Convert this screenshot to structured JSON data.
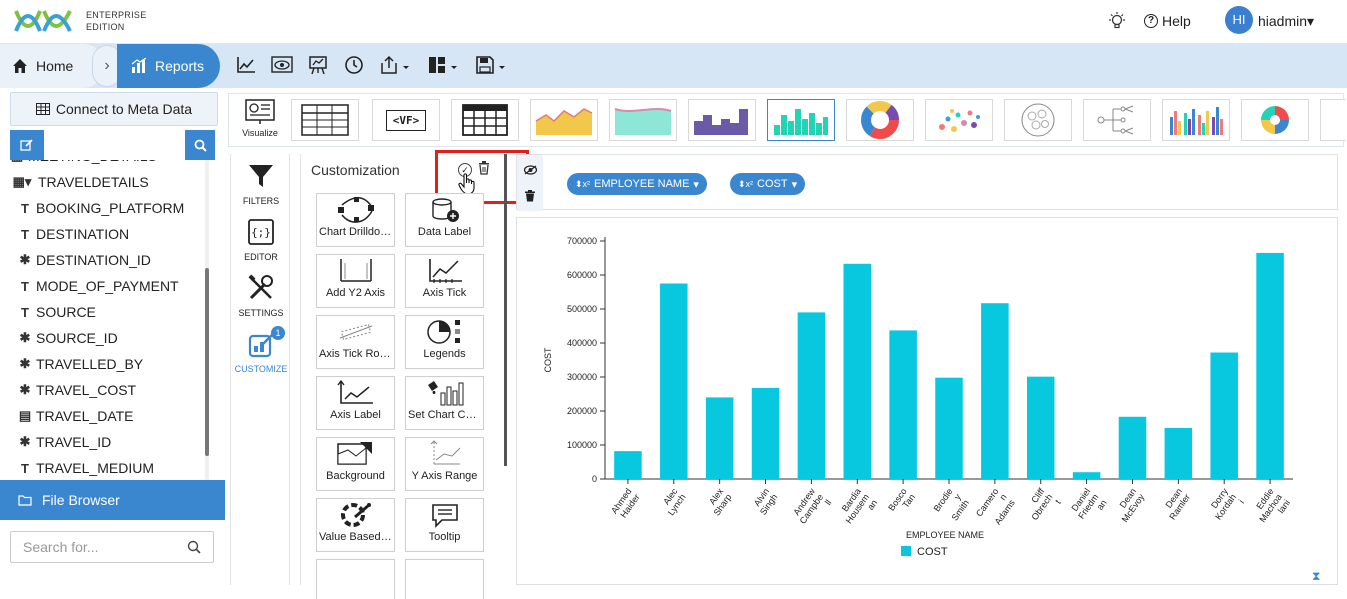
{
  "app": {
    "edition_line1": "ENTERPRISE",
    "edition_line2": "EDITION",
    "help_label": "Help",
    "avatar_initials": "HI",
    "username": "hiadmin",
    "accent_color": "#3a87d0"
  },
  "nav": {
    "home_label": "Home",
    "reports_label": "Reports"
  },
  "left_panel": {
    "connect_label": "Connect to Meta Data",
    "tree": [
      {
        "icon": "table-icon",
        "label": "MEETING_DETAILS"
      },
      {
        "icon": "table-expand-icon",
        "label": "TRAVELDETAILS"
      },
      {
        "icon": "text-type-icon",
        "label": "BOOKING_PLATFORM"
      },
      {
        "icon": "text-type-icon",
        "label": "DESTINATION"
      },
      {
        "icon": "numeric-type-icon",
        "label": "DESTINATION_ID"
      },
      {
        "icon": "text-type-icon",
        "label": "MODE_OF_PAYMENT"
      },
      {
        "icon": "text-type-icon",
        "label": "SOURCE"
      },
      {
        "icon": "numeric-type-icon",
        "label": "SOURCE_ID"
      },
      {
        "icon": "numeric-type-icon",
        "label": "TRAVELLED_BY"
      },
      {
        "icon": "numeric-type-icon",
        "label": "TRAVEL_COST"
      },
      {
        "icon": "date-type-icon",
        "label": "TRAVEL_DATE"
      },
      {
        "icon": "numeric-type-icon",
        "label": "TRAVEL_ID"
      },
      {
        "icon": "text-type-icon",
        "label": "TRAVEL_MEDIUM"
      }
    ],
    "file_browser_label": "File Browser",
    "search_placeholder": "Search for..."
  },
  "ribbon": {
    "visualize_label": "Visualize",
    "vf_label": "<VF>"
  },
  "sidenav": {
    "filters": "FILTERS",
    "editor": "EDITOR",
    "settings": "SETTINGS",
    "customize": "CUSTOMIZE",
    "customize_badge": "1"
  },
  "customization": {
    "title": "Customization",
    "tiles": [
      "Chart Drilldown",
      "Data Label",
      "Add Y2 Axis",
      "Axis Tick",
      "Axis Tick Rotation",
      "Legends",
      "Axis Label",
      "Set Chart Color",
      "Background",
      "Y Axis Range",
      "Value Based Color",
      "Tooltip"
    ]
  },
  "fields": {
    "dimension": "EMPLOYEE NAME",
    "measure": "COST"
  },
  "chart_data": {
    "type": "bar",
    "title": "",
    "xlabel": "EMPLOYEE NAME",
    "ylabel": "COST",
    "ylim": [
      0,
      700000
    ],
    "yticks": [
      0,
      100000,
      200000,
      300000,
      400000,
      500000,
      600000,
      700000
    ],
    "categories": [
      [
        "Ahmed",
        "Haider"
      ],
      [
        "Alec",
        "Lynch"
      ],
      [
        "Alex",
        "Sharp"
      ],
      [
        "Alvin",
        "Singh"
      ],
      [
        "Andrew",
        "Campbe",
        "ll"
      ],
      [
        "Bardia",
        "Housem",
        "an"
      ],
      [
        "Bosco",
        "Tan"
      ],
      [
        "Brodie",
        "y",
        "Smith"
      ],
      [
        "Camero",
        "n",
        "Adams"
      ],
      [
        "Cliff",
        "Obrech",
        "t"
      ],
      [
        "Daniel",
        "Friedm",
        "an"
      ],
      [
        "Dean",
        "McEvoy"
      ],
      [
        "Dean",
        "Ramler"
      ],
      [
        "Dorry",
        "Kordah",
        "i"
      ],
      [
        "Eddie",
        "Machoa",
        "lani"
      ]
    ],
    "series": [
      {
        "name": "COST",
        "color": "#08c8e0",
        "values": [
          82000,
          575000,
          240000,
          268000,
          490000,
          633000,
          437000,
          298000,
          517000,
          301000,
          20000,
          183000,
          150000,
          372000,
          665000
        ]
      }
    ],
    "legend": "bottom-center",
    "grid": false
  }
}
